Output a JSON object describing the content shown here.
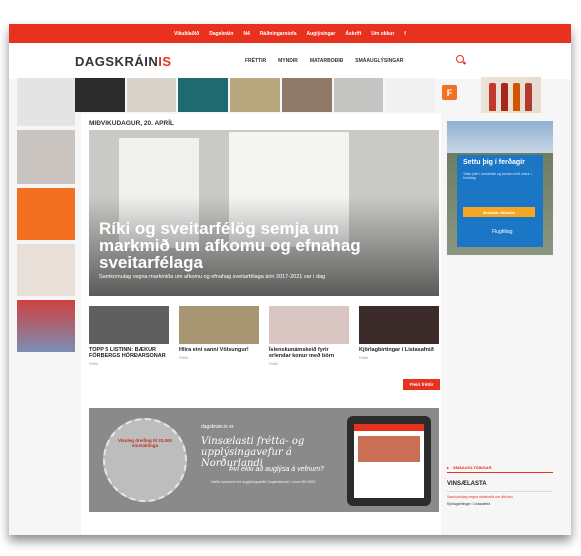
{
  "topbar": {
    "links": [
      "Vikublaðið",
      "Dagskráin",
      "N4",
      "Ráðningarstofa",
      "Auglýsingar",
      "Áskrift",
      "Um okkur",
      "f"
    ]
  },
  "header": {
    "logo_text": "DAGSKRÁIN",
    "logo_mark": "IS",
    "nav": [
      "FRÉTTIR",
      "MYNDIR",
      "MATARBOÐIÐ",
      "SMÁAUGLÝSINGAR"
    ]
  },
  "right_ad": {
    "small_letter": "F",
    "title": "Settu þig í ferðagír",
    "subtitle": "Taktu þátt í sumarleik og komdu með okkur í ferðalag",
    "button": "Skoðaðu tilboðin",
    "brand": "Flugfélag"
  },
  "main": {
    "date": "MIÐVIKUDAGUR, 20. APRÍL",
    "hero_headline": "Ríki og sveitarfélög semja um markmið um afkomu og efnahag sveitarfélaga",
    "hero_sub": "Samkomulag vegna markmiða um afkomu og efnahag sveitarfélaga árin 2017-2021 var í dag",
    "cards": [
      {
        "title": "TOPP 5 LISTINN: BÆKUR FÖRBERGS HÖRÐARSONAR",
        "meta": "Fréttir"
      },
      {
        "title": "Hlíra eini sanni Völsungur!",
        "meta": "Fréttir"
      },
      {
        "title": "Íslenskunámskeið fyrir erlendar konur með börn",
        "meta": "Fréttir"
      },
      {
        "title": "Kjörlagbirtingar í Listasafnið",
        "meta": "Fréttir"
      }
    ],
    "more_button": "Fleiri fréttir",
    "banner": {
      "coin_text": "Vikuleg dreifing til 33.000 einstaklinga",
      "tx1": "dagskrain.is er",
      "tx2": "Vinsælasti frétta- og upplýsingavefur á Norðurlandi",
      "tx3": "Því ekki að auglýsa á vefnum?",
      "tx4": "Hafðu samband við auglýsingadeild Dagskrárinnar í síma 460 9000"
    }
  },
  "right_section": {
    "header": "SMÁAUGLÝSINGAR",
    "popular": "VINSÆLASTA",
    "line1": "Samkomulag vegna markmiða um afkomu",
    "line2": "Kjörlagbirtingar í Listasafnið"
  }
}
